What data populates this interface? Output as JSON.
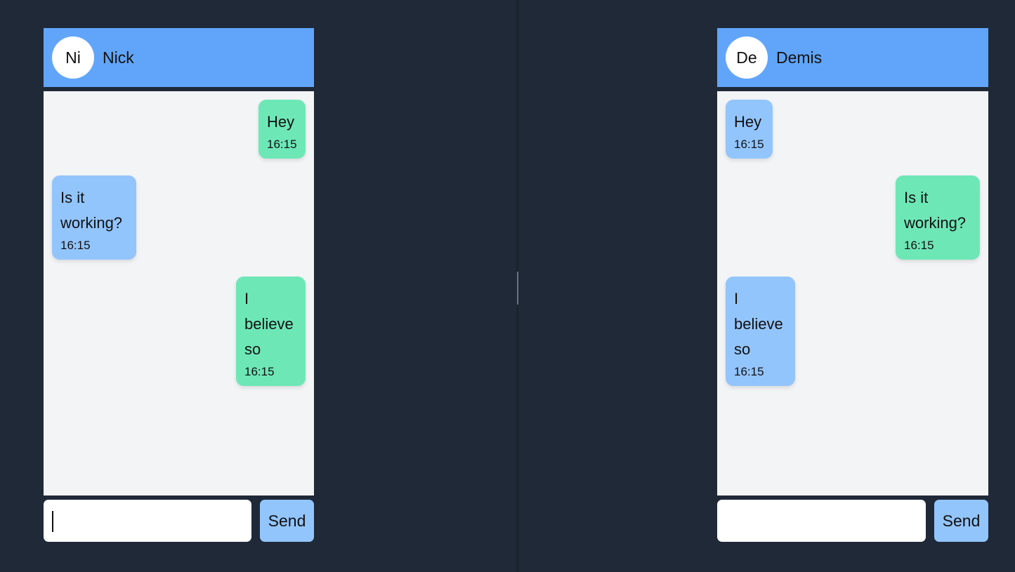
{
  "panes": [
    {
      "contact": {
        "initials": "Ni",
        "name": "Nick"
      },
      "messages": [
        {
          "type": "sent",
          "text": "Hey",
          "time": "16:15"
        },
        {
          "type": "received",
          "text": "Is it working?",
          "time": "16:15"
        },
        {
          "type": "sent",
          "text": "I believe so",
          "time": "16:15"
        }
      ],
      "composer": {
        "value": "",
        "placeholder": "",
        "send_label": "Send"
      }
    },
    {
      "contact": {
        "initials": "De",
        "name": "Demis"
      },
      "messages": [
        {
          "type": "received",
          "text": "Hey",
          "time": "16:15"
        },
        {
          "type": "sent",
          "text": "Is it working?",
          "time": "16:15"
        },
        {
          "type": "received",
          "text": "I believe so",
          "time": "16:15"
        }
      ],
      "composer": {
        "value": "",
        "placeholder": "",
        "send_label": "Send"
      }
    }
  ],
  "colors": {
    "background": "#1f2937",
    "header": "#60a5fa",
    "sent_bubble": "#6ee7b7",
    "received_bubble": "#93c5fd",
    "messages_bg": "#f3f4f6",
    "send_button": "#93c5fd"
  }
}
